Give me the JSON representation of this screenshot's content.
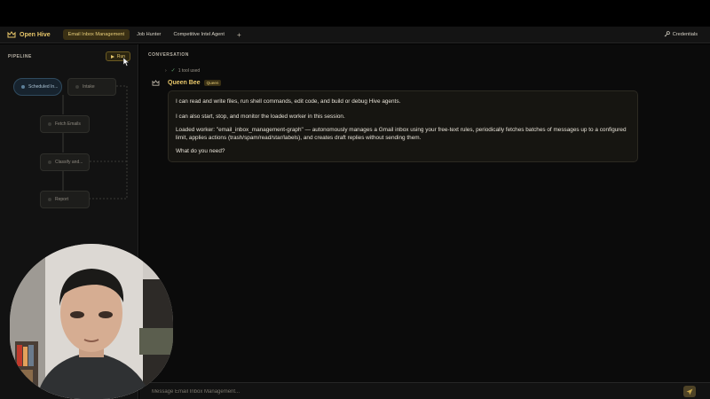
{
  "brand": {
    "name": "Open Hive",
    "icon": "crown-icon",
    "color": "#e7c66a"
  },
  "tabs": [
    {
      "label": "Email Inbox Management",
      "active": true
    },
    {
      "label": "Job Hunter",
      "active": false
    },
    {
      "label": "Competitive Intel Agent",
      "active": false
    }
  ],
  "new_tab_label": "+",
  "credentials": {
    "label": "Credentials",
    "icon": "key-icon"
  },
  "pipeline": {
    "label": "PIPELINE",
    "run_label": "Run",
    "nodes": [
      {
        "label": "Scheduled In...",
        "kind": "trigger"
      },
      {
        "label": "Intake"
      },
      {
        "label": "Fetch Emails"
      },
      {
        "label": "Classify and..."
      },
      {
        "label": "Report"
      }
    ]
  },
  "conversation": {
    "label": "CONVERSATION",
    "tool_summary": "1 tool used",
    "sender": "Queen Bee",
    "sender_badge": "Queen",
    "messages": [
      "I can read and write files, run shell commands, edit code, and build or debug Hive agents.",
      "I can also start, stop, and monitor the loaded worker in this session.",
      "Loaded worker: \"email_inbox_management-graph\" — autonomously manages a Gmail inbox using your free-text rules, periodically fetches batches of messages up to a configured limit, applies actions (trash/spam/read/star/labels), and creates draft replies without sending them.",
      "What do you need?"
    ]
  },
  "composer": {
    "placeholder": "Message Email Inbox Management...",
    "value": "",
    "send_icon": "send-icon"
  },
  "colors": {
    "accent": "#e7c66a",
    "background": "#0b0b0b",
    "sidebar": "#121212",
    "trigger": "#5c7f99"
  }
}
